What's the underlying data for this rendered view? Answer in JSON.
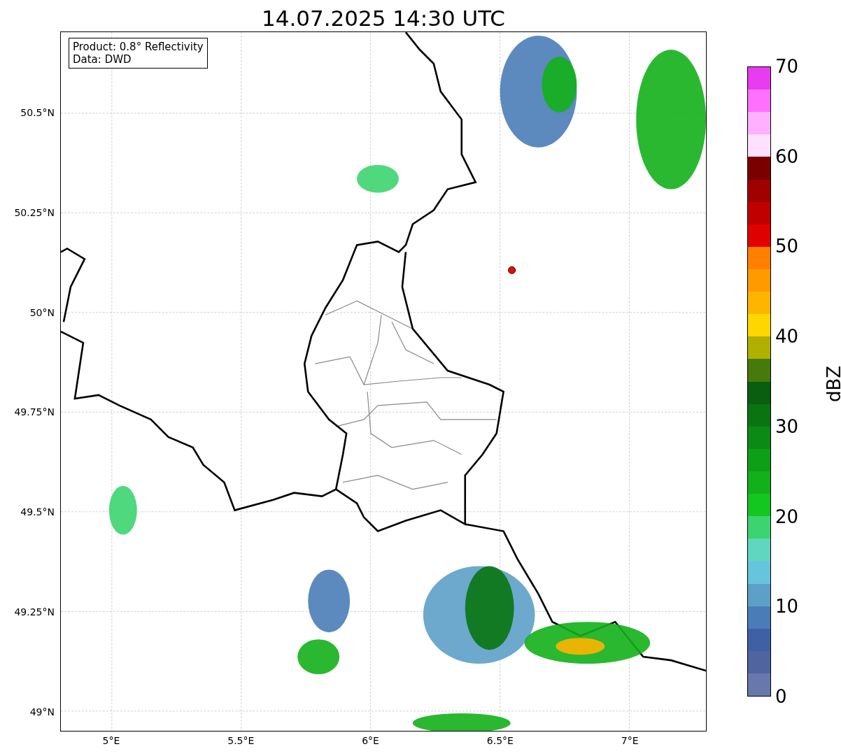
{
  "title": "14.07.2025 14:30 UTC",
  "legend": [
    "Product: 0.8° Reflectivity",
    "Data: DWD"
  ],
  "map": {
    "y_ticks": [
      "50.5°N",
      "50.25°N",
      "50°N",
      "49.75°N",
      "49.5°N",
      "49.25°N",
      "49°N"
    ],
    "x_ticks": [
      "5°E",
      "5.5°E",
      "6°E",
      "6.5°E",
      "7°E"
    ]
  },
  "colorbar": {
    "label": "dBZ",
    "ticks": [
      "70",
      "60",
      "50",
      "40",
      "30",
      "20",
      "10",
      "0"
    ],
    "bins": [
      {
        "color": "#e83cf0"
      },
      {
        "color": "#ff70ff"
      },
      {
        "color": "#ffb0ff"
      },
      {
        "color": "#ffe0ff"
      },
      {
        "color": "#7a0000"
      },
      {
        "color": "#a00000"
      },
      {
        "color": "#c00000"
      },
      {
        "color": "#e00000"
      },
      {
        "color": "#ff8000"
      },
      {
        "color": "#ff9a00"
      },
      {
        "color": "#ffb400"
      },
      {
        "color": "#ffd700"
      },
      {
        "color": "#b0b000"
      },
      {
        "color": "#467a0a"
      },
      {
        "color": "#0a5e10"
      },
      {
        "color": "#0a7412"
      },
      {
        "color": "#0c8a16"
      },
      {
        "color": "#0f9e18"
      },
      {
        "color": "#12b01a"
      },
      {
        "color": "#14c620"
      },
      {
        "color": "#3dd470"
      },
      {
        "color": "#60d6c0"
      },
      {
        "color": "#66c4dc"
      },
      {
        "color": "#5ca0c8"
      },
      {
        "color": "#4a7db8"
      },
      {
        "color": "#4060a6"
      },
      {
        "color": "#5065a0"
      },
      {
        "color": "#6878aa"
      }
    ]
  }
}
